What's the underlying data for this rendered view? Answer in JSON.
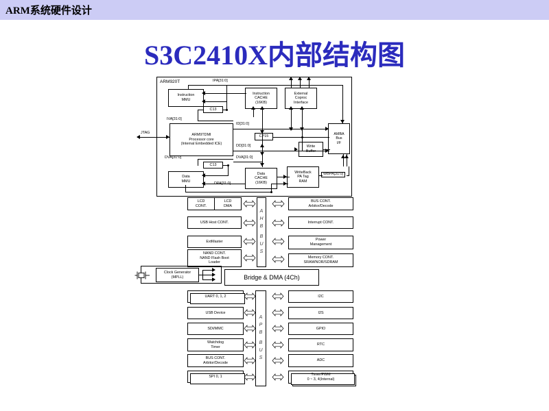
{
  "header": {
    "course_title": "ARM系统硬件设计"
  },
  "slide": {
    "title": "S3C2410X内部结构图"
  },
  "diagram": {
    "type": "block-diagram",
    "core_block": {
      "name": "ARM920T",
      "external_pin": "JTAG",
      "blocks": [
        {
          "id": "instruction-mmu",
          "label": "Instruction\nMMU"
        },
        {
          "id": "instruction-cache",
          "label": "Instruction\nCACHE\n(16KB)"
        },
        {
          "id": "external-coproc",
          "label": "External\nCoproc\nInterface"
        },
        {
          "id": "arm9tdmi-core",
          "label": "ARM9TDMI\nProcessor core\n(Internal Embedded ICE)"
        },
        {
          "id": "cp15",
          "label": "CP15"
        },
        {
          "id": "amba-bus-if",
          "label": "AMBA\nBus\nI/F"
        },
        {
          "id": "write-buffer",
          "label": "Write\nBuffer"
        },
        {
          "id": "c13-upper",
          "label": "C13"
        },
        {
          "id": "c13-lower",
          "label": "C13"
        },
        {
          "id": "data-mmu",
          "label": "Data\nMMU"
        },
        {
          "id": "data-cache",
          "label": "Data\nCACHE\n(16KB)"
        },
        {
          "id": "writeback-pa-tag-ram",
          "label": "WriteBack\nPA Tag\nRAM"
        }
      ],
      "bus_labels": [
        {
          "id": "ipa",
          "text": "IPA[31:0]"
        },
        {
          "id": "iva",
          "text": "IVA[31:0]"
        },
        {
          "id": "id",
          "text": "ID[31:0]"
        },
        {
          "id": "dd",
          "text": "DD[31:0]"
        },
        {
          "id": "dva-left",
          "text": "DVA[31:0]"
        },
        {
          "id": "dva-right",
          "text": "DVA[31:0]"
        },
        {
          "id": "dpa",
          "text": "DPA[31:0]"
        },
        {
          "id": "wbpa",
          "text": "WBPA[31:0]"
        }
      ]
    },
    "ahb_bus": {
      "spine_label": "AHB BUS",
      "spine_letters": [
        "A",
        "H",
        "B",
        "B",
        "U",
        "S"
      ],
      "left_masters": [
        {
          "id": "lcd-cont",
          "label": "LCD\nCONT."
        },
        {
          "id": "lcd-dma",
          "label": "LCD\nDMA"
        },
        {
          "id": "usb-host-cont",
          "label": "USB Host CONT."
        },
        {
          "id": "extmaster",
          "label": "ExtMaster"
        },
        {
          "id": "nand-cont",
          "label": "NAND CONT.\nNAND Flash Boot\nLoader"
        }
      ],
      "right_slaves": [
        {
          "id": "bus-cont-arbitor",
          "label": "BUS CONT.\nArbitor/Decode"
        },
        {
          "id": "interrupt-cont",
          "label": "Interrupt CONT."
        },
        {
          "id": "power-management",
          "label": "Power\nManagement"
        },
        {
          "id": "memory-cont",
          "label": "Memory CONT.\nSRAM/NOR/SDRAM"
        }
      ]
    },
    "clock": {
      "generator": "Clock Generator\n(MPLL)"
    },
    "bridge": {
      "label": "Bridge & DMA (4Ch)"
    },
    "apb_bus": {
      "spine_label": "APB BUS",
      "spine_letters": [
        "A",
        "P",
        "B",
        "B",
        "U",
        "S"
      ],
      "left_peripherals": [
        {
          "id": "uart",
          "label": "UART 0, 1, 2",
          "stacked": true
        },
        {
          "id": "usb-device",
          "label": "USB Device",
          "stacked": false
        },
        {
          "id": "sdi-mmc",
          "label": "SDI/MMC",
          "stacked": false
        },
        {
          "id": "watchdog-timer",
          "label": "Watchdog\nTimer",
          "stacked": false
        },
        {
          "id": "bus-cont-apb",
          "label": "BUS CONT.\nArbitor/Decode",
          "stacked": false
        },
        {
          "id": "spi",
          "label": "SPI 0, 1",
          "stacked": true
        }
      ],
      "right_peripherals": [
        {
          "id": "i2c",
          "label": "I2C",
          "stacked": false
        },
        {
          "id": "i2s",
          "label": "I2S",
          "stacked": false
        },
        {
          "id": "gpio",
          "label": "GPIO",
          "stacked": false
        },
        {
          "id": "rtc",
          "label": "RTC",
          "stacked": false
        },
        {
          "id": "adc",
          "label": "ADC",
          "stacked": false
        },
        {
          "id": "timer-pwm",
          "label": "Timer/PWM\n0 ~ 3, 4(Internal)",
          "stacked": true
        }
      ]
    }
  },
  "colors": {
    "header_bar": "#ccccf5",
    "title_text": "#2b2bbd",
    "diagram_line": "#000000",
    "page_background": "#ffffff"
  }
}
